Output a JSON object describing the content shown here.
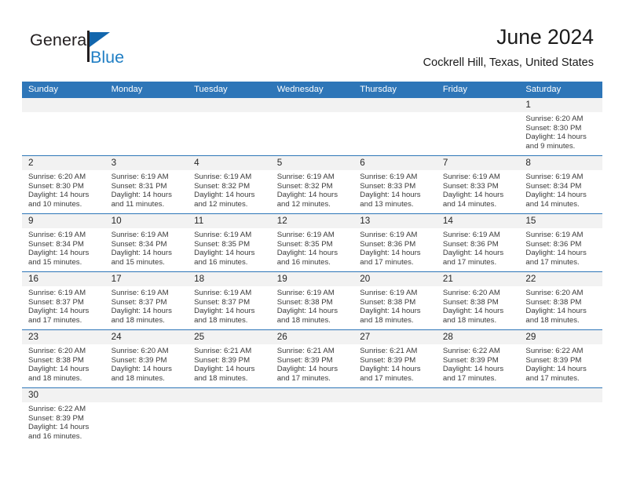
{
  "brand": {
    "name_part1": "General",
    "name_part2": "Blue",
    "color_dark": "#231f20",
    "color_blue": "#1f7ec4"
  },
  "header": {
    "title": "June 2024",
    "subtitle": "Cockrell Hill, Texas, United States",
    "accent_color": "#2e76b8"
  },
  "weekdays": [
    "Sunday",
    "Monday",
    "Tuesday",
    "Wednesday",
    "Thursday",
    "Friday",
    "Saturday"
  ],
  "weeks": [
    [
      {
        "day": "",
        "empty": true,
        "l1": "",
        "l2": "",
        "l3": "",
        "l4": ""
      },
      {
        "day": "",
        "empty": true,
        "l1": "",
        "l2": "",
        "l3": "",
        "l4": ""
      },
      {
        "day": "",
        "empty": true,
        "l1": "",
        "l2": "",
        "l3": "",
        "l4": ""
      },
      {
        "day": "",
        "empty": true,
        "l1": "",
        "l2": "",
        "l3": "",
        "l4": ""
      },
      {
        "day": "",
        "empty": true,
        "l1": "",
        "l2": "",
        "l3": "",
        "l4": ""
      },
      {
        "day": "",
        "empty": true,
        "l1": "",
        "l2": "",
        "l3": "",
        "l4": ""
      },
      {
        "day": "1",
        "empty": false,
        "l1": "Sunrise: 6:20 AM",
        "l2": "Sunset: 8:30 PM",
        "l3": "Daylight: 14 hours",
        "l4": "and 9 minutes."
      }
    ],
    [
      {
        "day": "2",
        "empty": false,
        "l1": "Sunrise: 6:20 AM",
        "l2": "Sunset: 8:30 PM",
        "l3": "Daylight: 14 hours",
        "l4": "and 10 minutes."
      },
      {
        "day": "3",
        "empty": false,
        "l1": "Sunrise: 6:19 AM",
        "l2": "Sunset: 8:31 PM",
        "l3": "Daylight: 14 hours",
        "l4": "and 11 minutes."
      },
      {
        "day": "4",
        "empty": false,
        "l1": "Sunrise: 6:19 AM",
        "l2": "Sunset: 8:32 PM",
        "l3": "Daylight: 14 hours",
        "l4": "and 12 minutes."
      },
      {
        "day": "5",
        "empty": false,
        "l1": "Sunrise: 6:19 AM",
        "l2": "Sunset: 8:32 PM",
        "l3": "Daylight: 14 hours",
        "l4": "and 12 minutes."
      },
      {
        "day": "6",
        "empty": false,
        "l1": "Sunrise: 6:19 AM",
        "l2": "Sunset: 8:33 PM",
        "l3": "Daylight: 14 hours",
        "l4": "and 13 minutes."
      },
      {
        "day": "7",
        "empty": false,
        "l1": "Sunrise: 6:19 AM",
        "l2": "Sunset: 8:33 PM",
        "l3": "Daylight: 14 hours",
        "l4": "and 14 minutes."
      },
      {
        "day": "8",
        "empty": false,
        "l1": "Sunrise: 6:19 AM",
        "l2": "Sunset: 8:34 PM",
        "l3": "Daylight: 14 hours",
        "l4": "and 14 minutes."
      }
    ],
    [
      {
        "day": "9",
        "empty": false,
        "l1": "Sunrise: 6:19 AM",
        "l2": "Sunset: 8:34 PM",
        "l3": "Daylight: 14 hours",
        "l4": "and 15 minutes."
      },
      {
        "day": "10",
        "empty": false,
        "l1": "Sunrise: 6:19 AM",
        "l2": "Sunset: 8:34 PM",
        "l3": "Daylight: 14 hours",
        "l4": "and 15 minutes."
      },
      {
        "day": "11",
        "empty": false,
        "l1": "Sunrise: 6:19 AM",
        "l2": "Sunset: 8:35 PM",
        "l3": "Daylight: 14 hours",
        "l4": "and 16 minutes."
      },
      {
        "day": "12",
        "empty": false,
        "l1": "Sunrise: 6:19 AM",
        "l2": "Sunset: 8:35 PM",
        "l3": "Daylight: 14 hours",
        "l4": "and 16 minutes."
      },
      {
        "day": "13",
        "empty": false,
        "l1": "Sunrise: 6:19 AM",
        "l2": "Sunset: 8:36 PM",
        "l3": "Daylight: 14 hours",
        "l4": "and 17 minutes."
      },
      {
        "day": "14",
        "empty": false,
        "l1": "Sunrise: 6:19 AM",
        "l2": "Sunset: 8:36 PM",
        "l3": "Daylight: 14 hours",
        "l4": "and 17 minutes."
      },
      {
        "day": "15",
        "empty": false,
        "l1": "Sunrise: 6:19 AM",
        "l2": "Sunset: 8:36 PM",
        "l3": "Daylight: 14 hours",
        "l4": "and 17 minutes."
      }
    ],
    [
      {
        "day": "16",
        "empty": false,
        "l1": "Sunrise: 6:19 AM",
        "l2": "Sunset: 8:37 PM",
        "l3": "Daylight: 14 hours",
        "l4": "and 17 minutes."
      },
      {
        "day": "17",
        "empty": false,
        "l1": "Sunrise: 6:19 AM",
        "l2": "Sunset: 8:37 PM",
        "l3": "Daylight: 14 hours",
        "l4": "and 18 minutes."
      },
      {
        "day": "18",
        "empty": false,
        "l1": "Sunrise: 6:19 AM",
        "l2": "Sunset: 8:37 PM",
        "l3": "Daylight: 14 hours",
        "l4": "and 18 minutes."
      },
      {
        "day": "19",
        "empty": false,
        "l1": "Sunrise: 6:19 AM",
        "l2": "Sunset: 8:38 PM",
        "l3": "Daylight: 14 hours",
        "l4": "and 18 minutes."
      },
      {
        "day": "20",
        "empty": false,
        "l1": "Sunrise: 6:19 AM",
        "l2": "Sunset: 8:38 PM",
        "l3": "Daylight: 14 hours",
        "l4": "and 18 minutes."
      },
      {
        "day": "21",
        "empty": false,
        "l1": "Sunrise: 6:20 AM",
        "l2": "Sunset: 8:38 PM",
        "l3": "Daylight: 14 hours",
        "l4": "and 18 minutes."
      },
      {
        "day": "22",
        "empty": false,
        "l1": "Sunrise: 6:20 AM",
        "l2": "Sunset: 8:38 PM",
        "l3": "Daylight: 14 hours",
        "l4": "and 18 minutes."
      }
    ],
    [
      {
        "day": "23",
        "empty": false,
        "l1": "Sunrise: 6:20 AM",
        "l2": "Sunset: 8:38 PM",
        "l3": "Daylight: 14 hours",
        "l4": "and 18 minutes."
      },
      {
        "day": "24",
        "empty": false,
        "l1": "Sunrise: 6:20 AM",
        "l2": "Sunset: 8:39 PM",
        "l3": "Daylight: 14 hours",
        "l4": "and 18 minutes."
      },
      {
        "day": "25",
        "empty": false,
        "l1": "Sunrise: 6:21 AM",
        "l2": "Sunset: 8:39 PM",
        "l3": "Daylight: 14 hours",
        "l4": "and 18 minutes."
      },
      {
        "day": "26",
        "empty": false,
        "l1": "Sunrise: 6:21 AM",
        "l2": "Sunset: 8:39 PM",
        "l3": "Daylight: 14 hours",
        "l4": "and 17 minutes."
      },
      {
        "day": "27",
        "empty": false,
        "l1": "Sunrise: 6:21 AM",
        "l2": "Sunset: 8:39 PM",
        "l3": "Daylight: 14 hours",
        "l4": "and 17 minutes."
      },
      {
        "day": "28",
        "empty": false,
        "l1": "Sunrise: 6:22 AM",
        "l2": "Sunset: 8:39 PM",
        "l3": "Daylight: 14 hours",
        "l4": "and 17 minutes."
      },
      {
        "day": "29",
        "empty": false,
        "l1": "Sunrise: 6:22 AM",
        "l2": "Sunset: 8:39 PM",
        "l3": "Daylight: 14 hours",
        "l4": "and 17 minutes."
      }
    ],
    [
      {
        "day": "30",
        "empty": false,
        "l1": "Sunrise: 6:22 AM",
        "l2": "Sunset: 8:39 PM",
        "l3": "Daylight: 14 hours",
        "l4": "and 16 minutes."
      },
      {
        "day": "",
        "empty": true,
        "l1": "",
        "l2": "",
        "l3": "",
        "l4": ""
      },
      {
        "day": "",
        "empty": true,
        "l1": "",
        "l2": "",
        "l3": "",
        "l4": ""
      },
      {
        "day": "",
        "empty": true,
        "l1": "",
        "l2": "",
        "l3": "",
        "l4": ""
      },
      {
        "day": "",
        "empty": true,
        "l1": "",
        "l2": "",
        "l3": "",
        "l4": ""
      },
      {
        "day": "",
        "empty": true,
        "l1": "",
        "l2": "",
        "l3": "",
        "l4": ""
      },
      {
        "day": "",
        "empty": true,
        "l1": "",
        "l2": "",
        "l3": "",
        "l4": ""
      }
    ]
  ]
}
